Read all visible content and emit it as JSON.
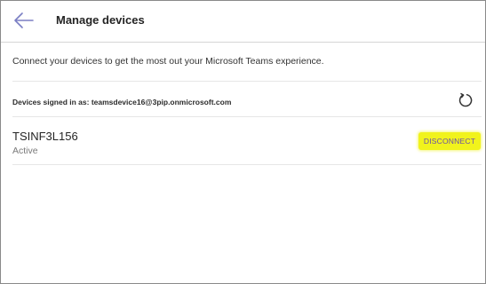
{
  "header": {
    "title": "Manage devices",
    "back_icon": "arrow-left-icon"
  },
  "subtitle": "Connect your devices to get the most out your Microsoft Teams experience.",
  "signed_in": {
    "label": "Devices signed in as: teamsdevice16@3pip.onmicrosoft.com",
    "refresh_icon": "refresh-icon"
  },
  "device": {
    "name": "TSINF3L156",
    "status": "Active",
    "action_label": "DISCONNECT"
  },
  "colors": {
    "accent": "#6b4fa8",
    "highlight": "#f1f31c",
    "back_arrow": "#7b7fc4"
  }
}
